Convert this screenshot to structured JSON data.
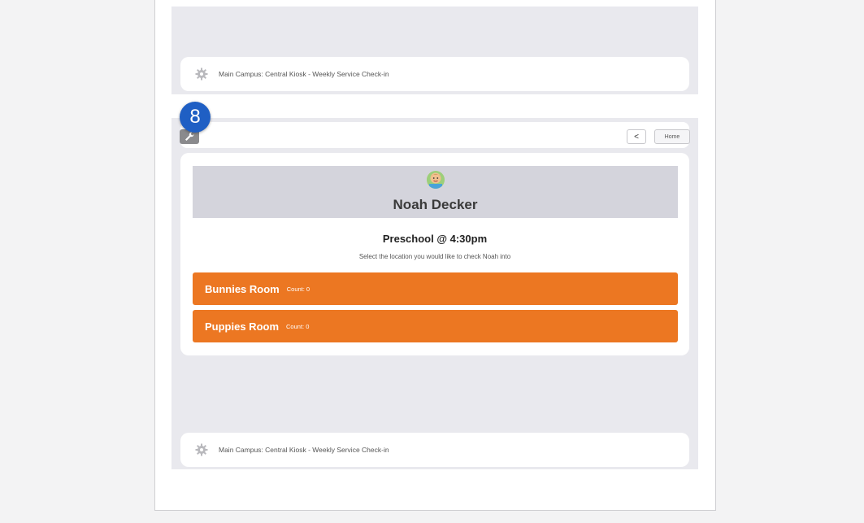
{
  "kiosk": {
    "footer_text": "Main Campus: Central Kiosk - Weekly Service Check-in",
    "step_number": "8"
  },
  "header": {
    "back_label": "<",
    "home_label": "Home"
  },
  "person": {
    "name": "Noah Decker"
  },
  "schedule": {
    "title": "Preschool @ 4:30pm",
    "instruction": "Select the location you would like to check Noah into"
  },
  "rooms": [
    {
      "name": "Bunnies Room",
      "count": "Count: 0"
    },
    {
      "name": "Puppies Room",
      "count": "Count: 0"
    }
  ],
  "colors": {
    "room_button": "#ec7722",
    "step_badge": "#1f5fc4",
    "screen_background": "#e9e9ee"
  },
  "icons": {
    "footer": "gear-icon",
    "admin": "wrench-icon",
    "person": "avatar"
  }
}
